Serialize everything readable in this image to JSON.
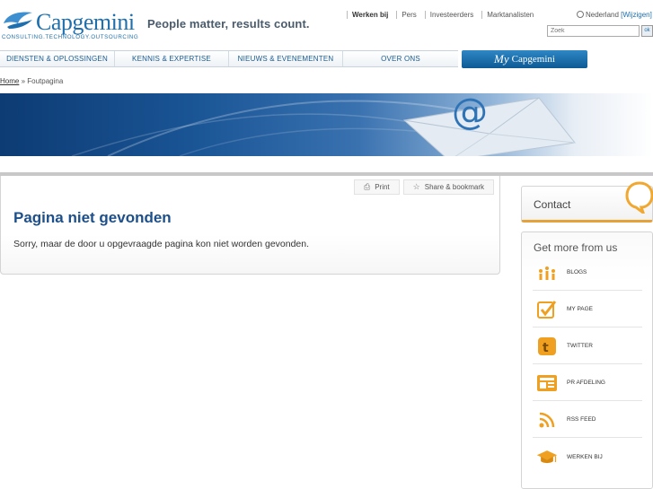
{
  "header": {
    "logo_name": "Capgemini",
    "logo_tagline": "CONSULTING.TECHNOLOGY.OUTSOURCING",
    "slogan": "People matter, results count.",
    "top_links": [
      "Werken bij",
      "Pers",
      "Investeerders",
      "Marktanalisten"
    ],
    "language": "Nederland",
    "language_change": "[Wijzigen]",
    "search_placeholder": "Zoek",
    "search_button": "ok"
  },
  "nav": {
    "items": [
      "DIENSTEN & OPLOSSINGEN",
      "KENNIS & EXPERTISE",
      "NIEUWS & EVENEMENTEN",
      "OVER ONS"
    ],
    "mycapgemini_my": "My",
    "mycapgemini_name": "Capgemini"
  },
  "breadcrumb": {
    "home": "Home",
    "separator": "»",
    "current": "Foutpagina"
  },
  "content": {
    "tools": [
      "Print",
      "Share & bookmark"
    ],
    "title": "Pagina niet gevonden",
    "message": "Sorry, maar de door u opgevraagde pagina kon niet worden gevonden."
  },
  "sidebar": {
    "contact_label": "Contact",
    "more_title": "Get more from us",
    "items": [
      {
        "label": "BLOGS",
        "icon": "blogs-icon"
      },
      {
        "label": "MY PAGE",
        "icon": "checkmark-icon"
      },
      {
        "label": "TWITTER",
        "icon": "twitter-icon"
      },
      {
        "label": "PR AFDELING",
        "icon": "news-icon"
      },
      {
        "label": "RSS FEED",
        "icon": "rss-icon"
      },
      {
        "label": "WERKEN BIJ",
        "icon": "graduation-cap-icon"
      }
    ]
  },
  "colors": {
    "brand_blue": "#1d6fae",
    "title_blue": "#1d4f8a",
    "accent_orange": "#e5a13a"
  }
}
